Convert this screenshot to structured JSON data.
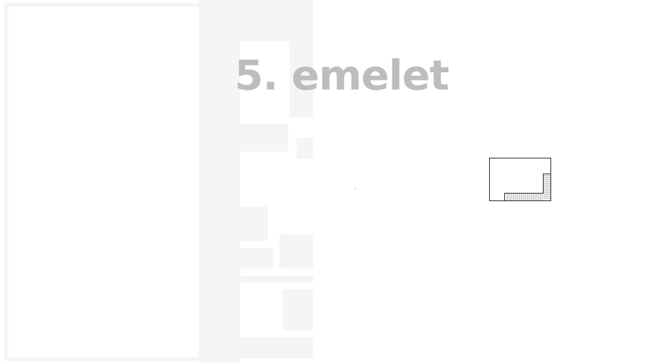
{
  "floor": {
    "title": "5. emelet"
  },
  "colors": {
    "background": "#ffffff",
    "title_gray": "#bdbdbd",
    "ghost_plan": "#f4f5f4",
    "minimap_stroke": "#222222"
  },
  "icons": {
    "background_plan": "floor-plan-watermark",
    "minimap": "floor-outline-map",
    "stairs": "staircase-hatch"
  }
}
